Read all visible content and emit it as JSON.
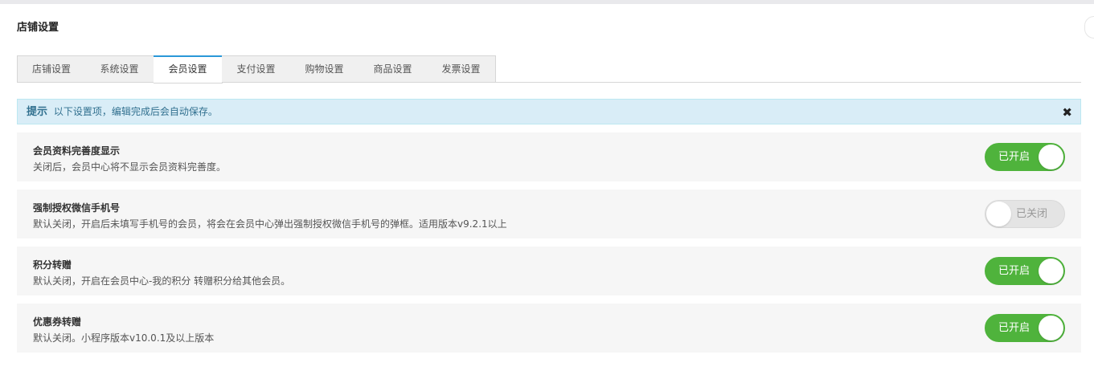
{
  "page": {
    "title": "店铺设置"
  },
  "tabs": [
    {
      "label": "店铺设置",
      "active": false
    },
    {
      "label": "系统设置",
      "active": false
    },
    {
      "label": "会员设置",
      "active": true
    },
    {
      "label": "支付设置",
      "active": false
    },
    {
      "label": "购物设置",
      "active": false
    },
    {
      "label": "商品设置",
      "active": false
    },
    {
      "label": "发票设置",
      "active": false
    }
  ],
  "alert": {
    "label": "提示",
    "text": "以下设置项，编辑完成后会自动保存。",
    "close_icon": "close-icon"
  },
  "settings": [
    {
      "title": "会员资料完善度显示",
      "desc": "关闭后，会员中心将不显示会员资料完善度。",
      "enabled": true,
      "toggle_label": "已开启"
    },
    {
      "title": "强制授权微信手机号",
      "desc": "默认关闭，开启后未填写手机号的会员，将会在会员中心弹出强制授权微信手机号的弹框。适用版本v9.2.1以上",
      "enabled": false,
      "toggle_label": "已关闭"
    },
    {
      "title": "积分转赠",
      "desc": "默认关闭，开启在会员中心-我的积分 转赠积分给其他会员。",
      "enabled": true,
      "toggle_label": "已开启"
    },
    {
      "title": "优惠券转赠",
      "desc": "默认关闭。小程序版本v10.0.1及以上版本",
      "enabled": true,
      "toggle_label": "已开启"
    }
  ],
  "colors": {
    "toggle_on": "#4fb33c",
    "toggle_off": "#e4e4e4",
    "alert_bg": "#d9edf7",
    "alert_text": "#31708f",
    "active_tab_accent": "#2a98d8"
  }
}
